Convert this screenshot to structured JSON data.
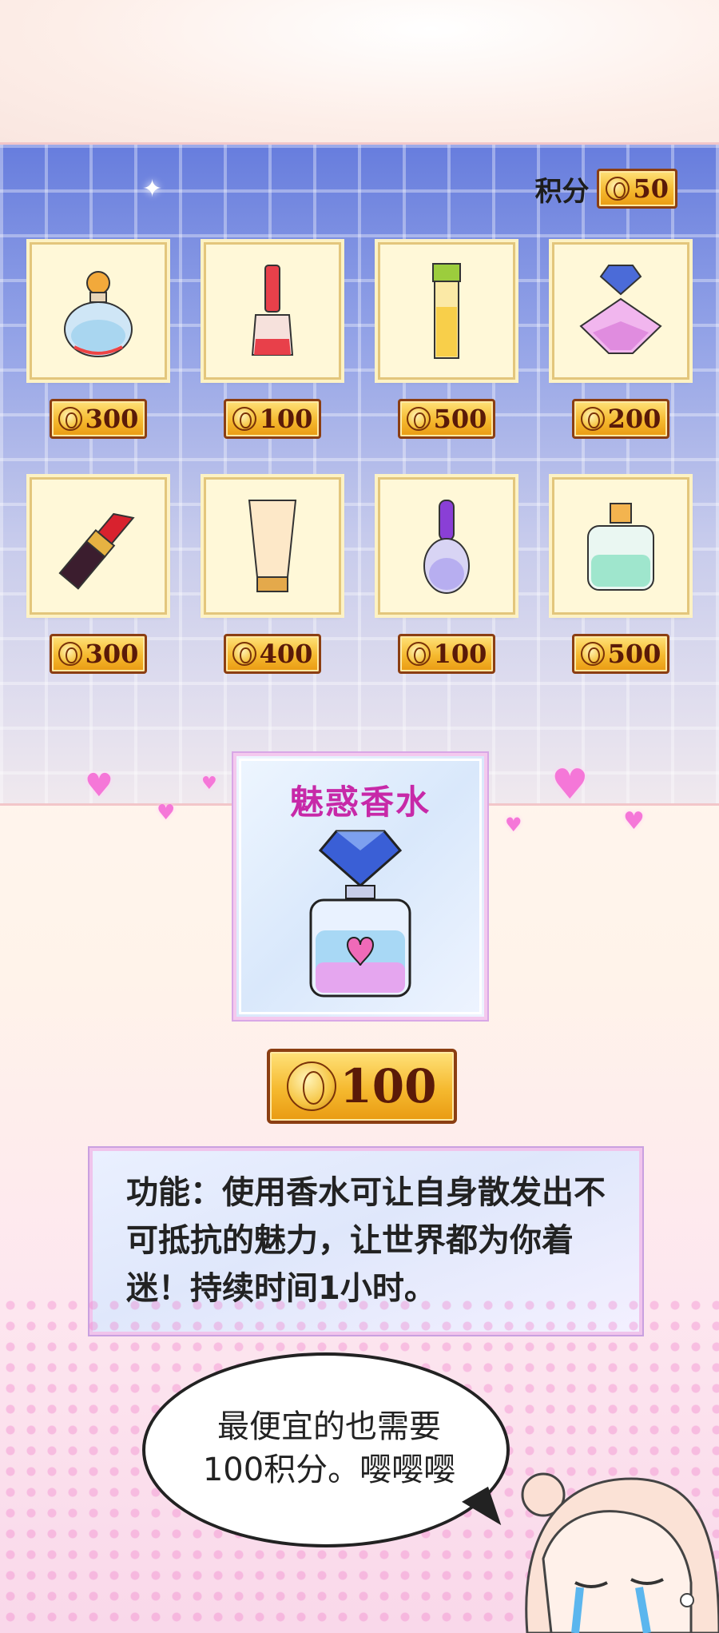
{
  "shop": {
    "points_label": "积分",
    "points_value": "50",
    "items": [
      {
        "icon": "round-perfume-icon",
        "price": "300"
      },
      {
        "icon": "nail-polish-icon",
        "price": "100"
      },
      {
        "icon": "slim-perfume-icon",
        "price": "500"
      },
      {
        "icon": "diamond-perfume-icon",
        "price": "200"
      },
      {
        "icon": "lipstick-icon",
        "price": "300"
      },
      {
        "icon": "lotion-tube-icon",
        "price": "400"
      },
      {
        "icon": "purple-bottle-icon",
        "price": "100"
      },
      {
        "icon": "square-perfume-icon",
        "price": "500"
      }
    ]
  },
  "featured": {
    "name": "魅惑香水",
    "icon": "charm-perfume-icon",
    "price": "100"
  },
  "description": {
    "text": "功能：使用香水可让自身散发出不可抵抗的魅力，让世界都为你着迷！持续时间1小时。"
  },
  "speech_bubble": {
    "line1": "最便宜的也需要",
    "line2": "100积分。嘤嘤嘤"
  },
  "colors": {
    "panel_blue": "#5a73dc",
    "gold": "#f5b92f",
    "title_pink": "#c729a8"
  }
}
